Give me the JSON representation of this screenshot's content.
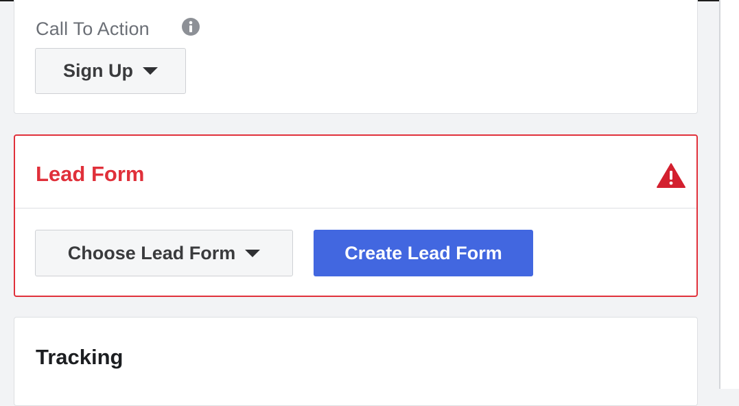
{
  "cta": {
    "label": "Call To Action",
    "selected": "Sign Up"
  },
  "lead_form": {
    "title": "Lead Form",
    "choose_label": "Choose Lead Form",
    "create_label": "Create Lead Form",
    "status": "error",
    "accent_color": "#e0303a"
  },
  "tracking": {
    "title": "Tracking"
  },
  "colors": {
    "primary_button": "#4267e0",
    "error": "#e0303a",
    "label_gray": "#6b6f76"
  },
  "icons": {
    "info": "info-icon",
    "warning": "warning-icon",
    "caret": "caret-down-icon"
  }
}
